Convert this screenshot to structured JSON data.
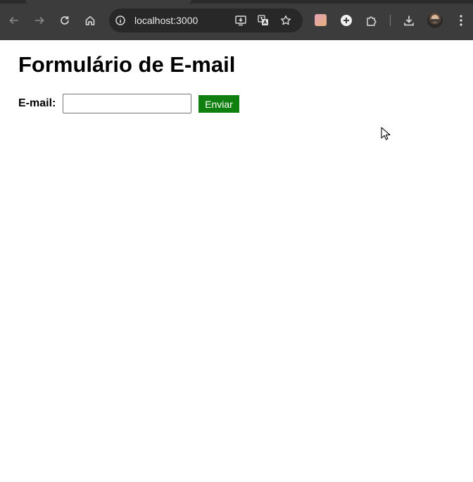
{
  "browser": {
    "url": "localhost:3000",
    "icons": {
      "back": "back-arrow-icon",
      "forward": "forward-arrow-icon",
      "reload": "reload-icon",
      "home": "home-icon",
      "site_info": "info-icon",
      "install": "install-app-icon",
      "translate": "translate-icon",
      "bookmark": "star-icon",
      "extension_color": "color-extension-icon",
      "extension_plus": "plus-circle-icon",
      "extensions": "puzzle-icon",
      "downloads": "download-icon",
      "profile": "avatar",
      "menu": "kebab-menu-icon"
    }
  },
  "page": {
    "title": "Formulário de E-mail",
    "form": {
      "email_label": "E-mail:",
      "email_value": "",
      "submit_label": "Enviar"
    }
  },
  "colors": {
    "toolbar": "#3c3c3c",
    "omnibox": "#282828",
    "button_bg": "#0f7f0f",
    "button_text": "#ffffff"
  }
}
